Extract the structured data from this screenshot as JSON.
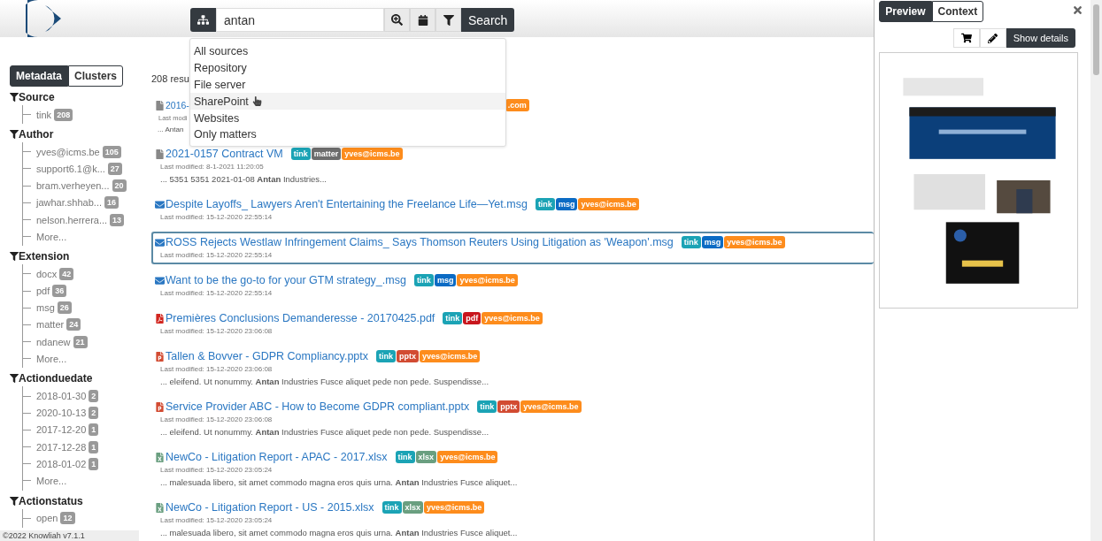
{
  "search": {
    "value": "antan",
    "button": "Search"
  },
  "source_menu": {
    "items": [
      {
        "label": "All sources",
        "hovered": false
      },
      {
        "label": "Repository",
        "hovered": false
      },
      {
        "label": "File server",
        "hovered": false
      },
      {
        "label": "SharePoint",
        "hovered": true
      },
      {
        "label": "Websites",
        "hovered": false
      },
      {
        "label": "Only matters",
        "hovered": false
      }
    ]
  },
  "sidebar": {
    "tabs": [
      {
        "label": "Metadata",
        "selected": true
      },
      {
        "label": "Clusters",
        "selected": false
      }
    ],
    "facets": [
      {
        "title": "Source",
        "items": [
          {
            "label": "tink",
            "count": "208"
          }
        ]
      },
      {
        "title": "Author",
        "items": [
          {
            "label": "yves@icms.be",
            "count": "105"
          },
          {
            "label": "support6.1@k...",
            "count": "27"
          },
          {
            "label": "bram.verheyen...",
            "count": "20"
          },
          {
            "label": "jawhar.shhab...",
            "count": "16"
          },
          {
            "label": "nelson.herrera...",
            "count": "13"
          },
          {
            "label": "More..."
          }
        ]
      },
      {
        "title": "Extension",
        "items": [
          {
            "label": "docx",
            "count": "42"
          },
          {
            "label": "pdf",
            "count": "36"
          },
          {
            "label": "msg",
            "count": "26"
          },
          {
            "label": "matter",
            "count": "24"
          },
          {
            "label": "ndanew",
            "count": "21"
          },
          {
            "label": "More..."
          }
        ]
      },
      {
        "title": "Actionduedate",
        "items": [
          {
            "label": "2018-01-30",
            "count": "2"
          },
          {
            "label": "2020-10-13",
            "count": "2"
          },
          {
            "label": "2017-12-20",
            "count": "1"
          },
          {
            "label": "2017-12-28",
            "count": "1"
          },
          {
            "label": "2018-01-02",
            "count": "1"
          },
          {
            "label": "More..."
          }
        ]
      },
      {
        "title": "Actionstatus",
        "items": [
          {
            "label": "open",
            "count": "12"
          }
        ]
      }
    ]
  },
  "results": {
    "count": "208 resu",
    "items": [
      {
        "kind": "doc",
        "title": "2016-",
        "selected": false,
        "modified": "Last modi",
        "snippet": "... Antan",
        "tags": [
          {
            "label": ".com",
            "color": "#fd8c1c"
          }
        ]
      },
      {
        "kind": "doc",
        "title": "2021-0157 Contract VM",
        "selected": false,
        "modified": "Last modified: 8-1-2021 11:20:05",
        "snippet": "... 5351 5351 2021-01-08 **Antan** Industries...",
        "tags": [
          {
            "label": "tink",
            "color": "#1ba3b5"
          },
          {
            "label": "matter",
            "color": "#6c6c6c"
          },
          {
            "label": "yves@icms.be",
            "color": "#fd8c1c"
          }
        ]
      },
      {
        "kind": "mail",
        "title": "Despite Layoffs_ Lawyers Aren't Entertaining the Freelance Life—Yet.msg",
        "selected": false,
        "modified": "Last modified: 15-12-2020 22:55:14",
        "tags": [
          {
            "label": "tink",
            "color": "#1ba3b5"
          },
          {
            "label": "msg",
            "color": "#0b6bc4"
          },
          {
            "label": "yves@icms.be",
            "color": "#fd8c1c"
          }
        ]
      },
      {
        "kind": "mail",
        "title": "ROSS Rejects Westlaw Infringement Claims_ Says Thomson Reuters Using Litigation as 'Weapon'.msg",
        "selected": true,
        "modified": "Last modified: 15-12-2020 22:55:14",
        "tags": [
          {
            "label": "tink",
            "color": "#1ba3b5"
          },
          {
            "label": "msg",
            "color": "#0b6bc4"
          },
          {
            "label": "yves@icms.be",
            "color": "#fd8c1c"
          }
        ]
      },
      {
        "kind": "mail",
        "title": "Want to be the go-to for your GTM strategy_.msg",
        "selected": false,
        "modified": "Last modified: 15-12-2020 22:55:14",
        "tags": [
          {
            "label": "tink",
            "color": "#1ba3b5"
          },
          {
            "label": "msg",
            "color": "#0b6bc4"
          },
          {
            "label": "yves@icms.be",
            "color": "#fd8c1c"
          }
        ]
      },
      {
        "kind": "pdf",
        "title": "Premières Conclusions Demanderesse - 20170425.pdf",
        "selected": false,
        "modified": "Last modified: 15-12-2020 23:06:08",
        "tags": [
          {
            "label": "tink",
            "color": "#1ba3b5"
          },
          {
            "label": "pdf",
            "color": "#c8161d"
          },
          {
            "label": "yves@icms.be",
            "color": "#fd8c1c"
          }
        ]
      },
      {
        "kind": "pptx",
        "title": "Tallen & Bovver - GDPR Compliancy.pptx",
        "selected": false,
        "modified": "Last modified: 15-12-2020 23:06:08",
        "snippet": "... eleifend. Ut nonummy. **Antan** Industries Fusce aliquet pede non pede. Suspendisse...",
        "tags": [
          {
            "label": "tink",
            "color": "#1ba3b5"
          },
          {
            "label": "pptx",
            "color": "#d24b32"
          },
          {
            "label": "yves@icms.be",
            "color": "#fd8c1c"
          }
        ]
      },
      {
        "kind": "pptx",
        "title": "Service Provider ABC - How to Become GDPR compliant.pptx",
        "selected": false,
        "modified": "Last modified: 15-12-2020 23:06:08",
        "snippet": "... eleifend. Ut nonummy. **Antan** Industries Fusce aliquet pede non pede. Suspendisse...",
        "tags": [
          {
            "label": "tink",
            "color": "#1ba3b5"
          },
          {
            "label": "pptx",
            "color": "#d24b32"
          },
          {
            "label": "yves@icms.be",
            "color": "#fd8c1c"
          }
        ]
      },
      {
        "kind": "xlsx",
        "title": "NewCo - Litigation Report - APAC - 2017.xlsx",
        "selected": false,
        "modified": "Last modified: 15-12-2020 23:05:24",
        "snippet": "... malesuada libero, sit amet commodo magna eros quis urna. **Antan** Industries Fusce aliquet...",
        "tags": [
          {
            "label": "tink",
            "color": "#1ba3b5"
          },
          {
            "label": "xlsx",
            "color": "#6a9f80"
          },
          {
            "label": "yves@icms.be",
            "color": "#fd8c1c"
          }
        ]
      },
      {
        "kind": "xlsx",
        "title": "NewCo - Litigation Report - US - 2015.xlsx",
        "selected": false,
        "modified": "Last modified: 15-12-2020 23:05:24",
        "snippet": "... malesuada libero, sit amet commodo magna eros quis urna. **Antan** Industries Fusce aliquet...",
        "tags": [
          {
            "label": "tink",
            "color": "#1ba3b5"
          },
          {
            "label": "xlsx",
            "color": "#6a9f80"
          },
          {
            "label": "yves@icms.be",
            "color": "#fd8c1c"
          }
        ]
      }
    ]
  },
  "preview_panel": {
    "tabs": [
      {
        "label": "Preview",
        "selected": true
      },
      {
        "label": "Context",
        "selected": false
      }
    ],
    "details_button": "Show details"
  },
  "footer": "©2022 Knowliah v7.1.1"
}
